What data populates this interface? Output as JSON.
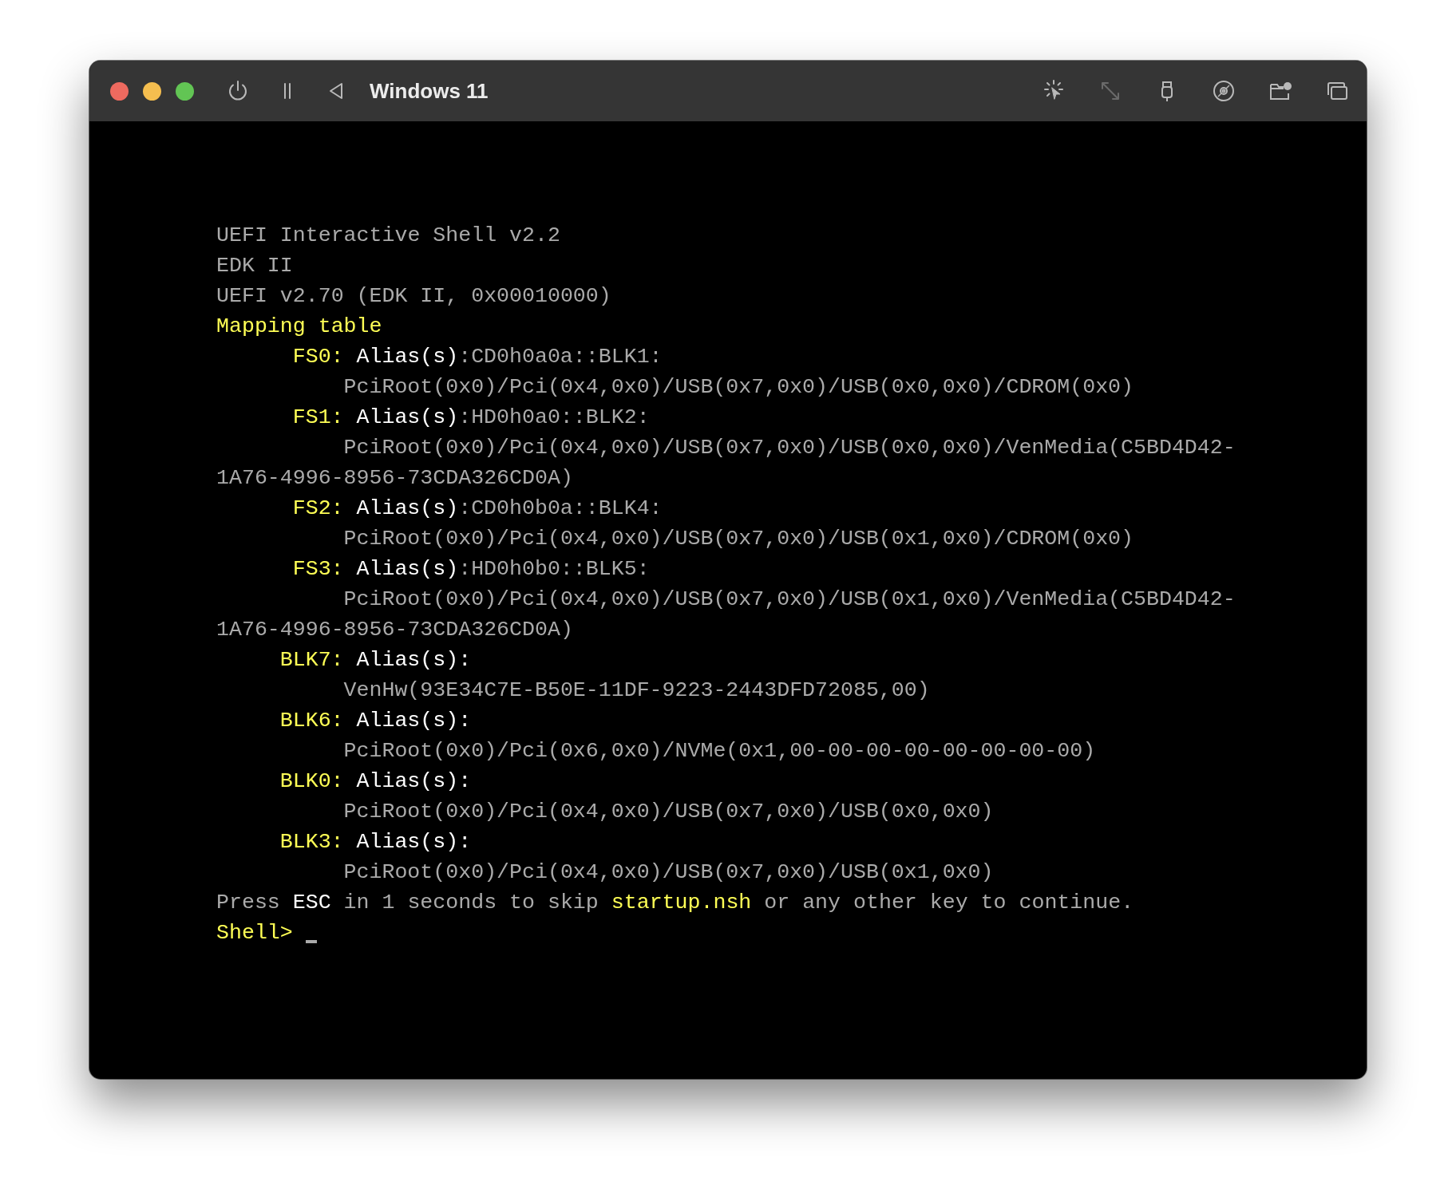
{
  "window": {
    "title": "Windows 11"
  },
  "toolbar_left": [
    {
      "kind": "power",
      "disabled": false
    },
    {
      "kind": "pause",
      "disabled": false
    },
    {
      "kind": "back",
      "disabled": false
    }
  ],
  "toolbar_right": [
    {
      "kind": "pointer",
      "disabled": false
    },
    {
      "kind": "resize",
      "disabled": true
    },
    {
      "kind": "usb",
      "disabled": false
    },
    {
      "kind": "disc",
      "disabled": false
    },
    {
      "kind": "folder",
      "disabled": false
    },
    {
      "kind": "windows",
      "disabled": false
    }
  ],
  "terminal": {
    "lines": [
      {
        "kind": "plain",
        "segments": [
          {
            "text": "UEFI Interactive Shell v2.2",
            "color": "#aaaaaa"
          }
        ]
      },
      {
        "kind": "plain",
        "segments": [
          {
            "text": "EDK II",
            "color": "#aaaaaa"
          }
        ]
      },
      {
        "kind": "plain",
        "segments": [
          {
            "text": "UEFI v2.70 (EDK II, 0x00010000)",
            "color": "#aaaaaa"
          }
        ]
      },
      {
        "kind": "plain",
        "segments": [
          {
            "text": "Mapping table",
            "color": "#ffff55"
          }
        ]
      },
      {
        "kind": "mapping",
        "label": "FS0:",
        "segments": [
          {
            "text": "Alias(s)",
            "color": "#ffffff"
          },
          {
            "text": ":CD0h0a0a::BLK1:",
            "color": "#aaaaaa"
          }
        ]
      },
      {
        "kind": "path",
        "segments": [
          {
            "text": "PciRoot(0x0)/Pci(0x4,0x0)/USB(0x7,0x0)/USB(0x0,0x0)/CDROM(0x0)",
            "color": "#aaaaaa"
          }
        ]
      },
      {
        "kind": "mapping",
        "label": "FS1:",
        "segments": [
          {
            "text": "Alias(s)",
            "color": "#ffffff"
          },
          {
            "text": ":HD0h0a0::BLK2:",
            "color": "#aaaaaa"
          }
        ]
      },
      {
        "kind": "path",
        "segments": [
          {
            "text": "PciRoot(0x0)/Pci(0x4,0x0)/USB(0x7,0x0)/USB(0x0,0x0)/VenMedia(C5BD4D42-",
            "color": "#aaaaaa"
          }
        ]
      },
      {
        "kind": "plain",
        "segments": [
          {
            "text": "1A76-4996-8956-73CDA326CD0A)",
            "color": "#aaaaaa"
          }
        ]
      },
      {
        "kind": "mapping",
        "label": "FS2:",
        "segments": [
          {
            "text": "Alias(s)",
            "color": "#ffffff"
          },
          {
            "text": ":CD0h0b0a::BLK4:",
            "color": "#aaaaaa"
          }
        ]
      },
      {
        "kind": "path",
        "segments": [
          {
            "text": "PciRoot(0x0)/Pci(0x4,0x0)/USB(0x7,0x0)/USB(0x1,0x0)/CDROM(0x0)",
            "color": "#aaaaaa"
          }
        ]
      },
      {
        "kind": "mapping",
        "label": "FS3:",
        "segments": [
          {
            "text": "Alias(s)",
            "color": "#ffffff"
          },
          {
            "text": ":HD0h0b0::BLK5:",
            "color": "#aaaaaa"
          }
        ]
      },
      {
        "kind": "path",
        "segments": [
          {
            "text": "PciRoot(0x0)/Pci(0x4,0x0)/USB(0x7,0x0)/USB(0x1,0x0)/VenMedia(C5BD4D42-",
            "color": "#aaaaaa"
          }
        ]
      },
      {
        "kind": "plain",
        "segments": [
          {
            "text": "1A76-4996-8956-73CDA326CD0A)",
            "color": "#aaaaaa"
          }
        ]
      },
      {
        "kind": "mapping",
        "label": "BLK7:",
        "segments": [
          {
            "text": "Alias(s):",
            "color": "#ffffff"
          }
        ]
      },
      {
        "kind": "path",
        "segments": [
          {
            "text": "VenHw(93E34C7E-B50E-11DF-9223-2443DFD72085,00)",
            "color": "#aaaaaa"
          }
        ]
      },
      {
        "kind": "mapping",
        "label": "BLK6:",
        "segments": [
          {
            "text": "Alias(s):",
            "color": "#ffffff"
          }
        ]
      },
      {
        "kind": "path",
        "segments": [
          {
            "text": "PciRoot(0x0)/Pci(0x6,0x0)/NVMe(0x1,00-00-00-00-00-00-00-00)",
            "color": "#aaaaaa"
          }
        ]
      },
      {
        "kind": "mapping",
        "label": "BLK0:",
        "segments": [
          {
            "text": "Alias(s):",
            "color": "#ffffff"
          }
        ]
      },
      {
        "kind": "path",
        "segments": [
          {
            "text": "PciRoot(0x0)/Pci(0x4,0x0)/USB(0x7,0x0)/USB(0x0,0x0)",
            "color": "#aaaaaa"
          }
        ]
      },
      {
        "kind": "mapping",
        "label": "BLK3:",
        "segments": [
          {
            "text": "Alias(s):",
            "color": "#ffffff"
          }
        ]
      },
      {
        "kind": "path",
        "segments": [
          {
            "text": "PciRoot(0x0)/Pci(0x4,0x0)/USB(0x7,0x0)/USB(0x1,0x0)",
            "color": "#aaaaaa"
          }
        ]
      },
      {
        "kind": "plain",
        "segments": [
          {
            "text": "Press ",
            "color": "#aaaaaa"
          },
          {
            "text": "ESC",
            "color": "#ffffff"
          },
          {
            "text": " in 1 seconds to skip ",
            "color": "#aaaaaa"
          },
          {
            "text": "startup.nsh",
            "color": "#ffff55"
          },
          {
            "text": " or any other key to continue.",
            "color": "#aaaaaa"
          }
        ]
      },
      {
        "kind": "prompt",
        "segments": [
          {
            "text": "Shell>",
            "color": "#ffff55"
          }
        ]
      }
    ]
  }
}
